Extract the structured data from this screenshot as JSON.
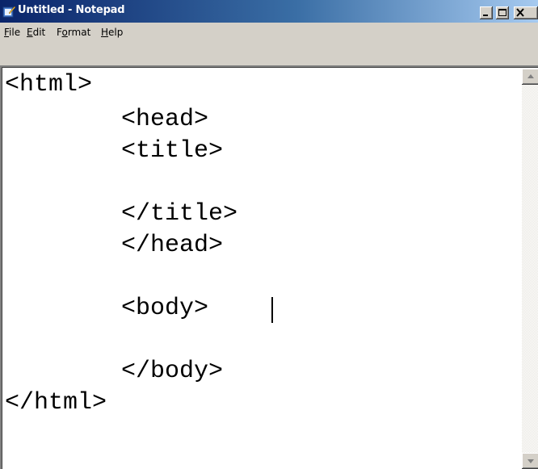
{
  "window": {
    "title": "Untitled - Notepad",
    "icon": "notepad-icon"
  },
  "caption_buttons": {
    "minimize_icon": "minimize-icon",
    "maximize_icon": "maximize-icon",
    "close_icon": "close-icon"
  },
  "menu": {
    "items": [
      {
        "accel": "F",
        "rest": "ile"
      },
      {
        "accel": "E",
        "rest": "dit"
      },
      {
        "pre": "F",
        "accel": "o",
        "rest": "rmat"
      },
      {
        "accel": "H",
        "rest": "elp"
      }
    ]
  },
  "editor": {
    "lines": [
      "<html>",
      "        <head>",
      "        <title>",
      "",
      "        </title>",
      "        </head>",
      "",
      "        <body>",
      "",
      "        </body>",
      "</html>"
    ]
  },
  "colors": {
    "titlebar_start": "#0a246a",
    "titlebar_end": "#a6caf0",
    "chrome": "#d4d0c8"
  }
}
